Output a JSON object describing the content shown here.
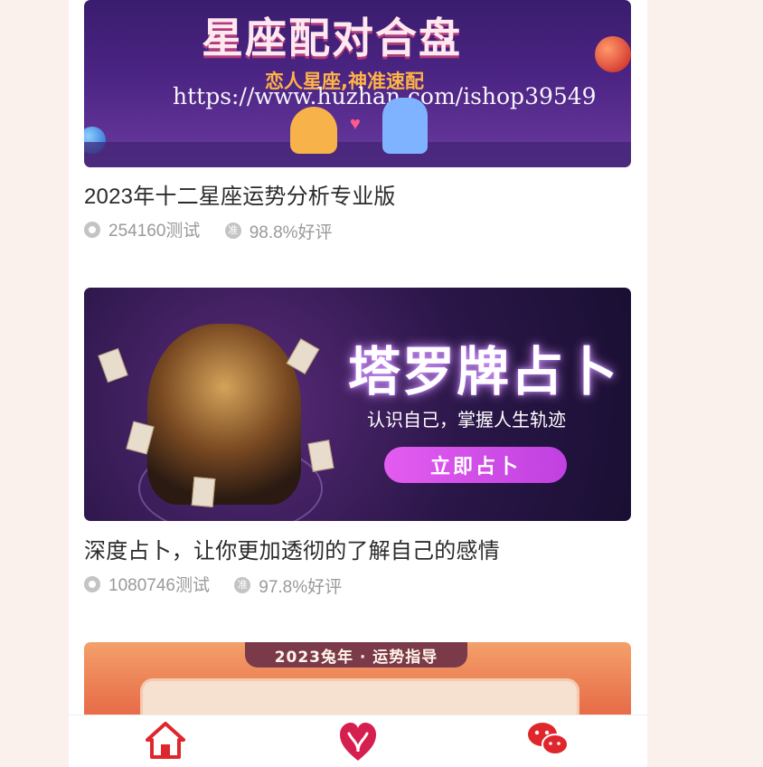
{
  "cards": [
    {
      "banner": {
        "headline": "星座配对合盘",
        "subline": "恋人星座,神准速配",
        "watermark": "https://www.huzhan.com/ishop39549"
      },
      "title": "2023年十二星座运势分析专业版",
      "tests": "254160测试",
      "rating": "98.8%好评",
      "badge_glyph": "准"
    },
    {
      "banner": {
        "headline": "塔罗牌占卜",
        "subline": "认识自己，掌握人生轨迹",
        "cta": "立即占卜"
      },
      "title": "深度占卜，让你更加透彻的了解自己的感情",
      "tests": "1080746测试",
      "rating": "97.8%好评",
      "badge_glyph": "准"
    },
    {
      "banner": {
        "ribbon": "2023兔年 · 运势指导"
      }
    }
  ],
  "tabbar": {
    "items": [
      {
        "icon": "home-icon",
        "active": true
      },
      {
        "icon": "heart-logo-icon",
        "active": false
      },
      {
        "icon": "wechat-icon",
        "active": false
      }
    ],
    "accent": "#e0262d"
  }
}
